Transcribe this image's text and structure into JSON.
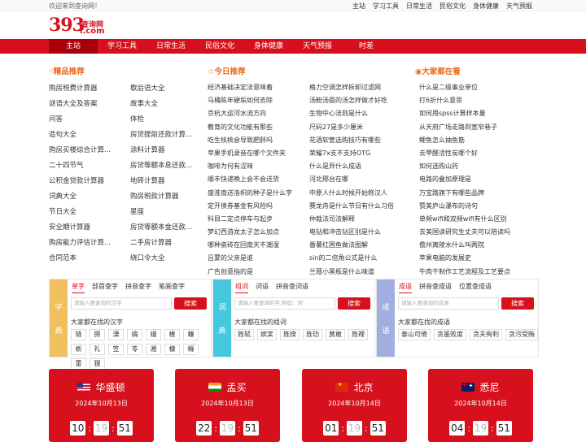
{
  "topbar": {
    "welcome": "欢迎来到查询网！",
    "links": [
      "主站",
      "学习工具",
      "日常生活",
      "民俗文化",
      "身体健康",
      "天气预报"
    ]
  },
  "logo": {
    "digits": "393",
    "cn": "查询网",
    "com": "r.com"
  },
  "nav": {
    "items": [
      "主站",
      "学习工具",
      "日常生活",
      "民俗文化",
      "身体健康",
      "天气预报",
      "时差"
    ]
  },
  "recommend": {
    "title": "精品推荐",
    "items": [
      "购房税费计算器",
      "歇后语大全",
      "谜语大全及答案",
      "故事大全",
      "问答",
      "体检",
      "造句大全",
      "房贷提前还款计算...",
      "购房买楼综合计算...",
      "涂料计算器",
      "二十四节气",
      "房贷等额本息还款...",
      "公积金贷款计算器",
      "地砖计算器",
      "词典大全",
      "购房税款计算器",
      "节日大全",
      "星座",
      "安全期计算器",
      "房贷等额本金还款...",
      "购房能力评估计算...",
      "二手房计算器",
      "合同范本",
      "绕口令大全"
    ]
  },
  "today": {
    "title": "今日推荐",
    "items": [
      "经济基础决定法意味着",
      "格力空调怎样拆卸过滤网",
      "马桶陈年硬垢如何去除",
      "汤粉汤面的汤怎样做才好吃",
      "京杭大运河水流方向",
      "生物中心法则是什么",
      "教育的文化功能有那些",
      "尺码27是多少厘米",
      "吃生核桃会导致肥胖吗",
      "花酒软管选购技巧有哪些",
      "苹果手机录音在哪个文件夹",
      "荣耀7x支不支持OTG",
      "咖啡为何有涩味",
      "什么是异什么成语",
      "顺丰快递晚上会不会送货",
      "河北邢台在哪",
      "盛淮南送洛枳的种子是什么字",
      "中原人什么时候开始称汉人",
      "定开债券基金有风险吗",
      "赛龙舟是什么节日有什么习俗",
      "科目二定点停车与起步",
      "仲裁法司法解释",
      "梦幻西游龙太子怎么加点",
      "电钻和冲击钻区别是什么",
      "哪种瓷砖在回南天不潮湿",
      "番薯红困鱼做法图解",
      "吕蒙的父亲是谁",
      "sin的二倍角公式是什么",
      "广告创意指的是",
      "兰蔻小黑瓶是什么味道"
    ]
  },
  "watching": {
    "title": "大家都在看",
    "items": [
      "什么是二级事业单位",
      "打6折什么意思",
      "如何用spss计算样本量",
      "从天府广场走路到宽窄巷子",
      "鲤鱼怎么抽鱼筋",
      "去甲醛活性炭哪个好",
      "如何选购山药",
      "电路的叠加原理是",
      "万宝路旗下有哪些品牌",
      "赞美庐山瀑布的诗句",
      "单频wifi和双频wifi有什么区别",
      "去美国读研究生丈夫可以陪读吗",
      "儋州离陵水什么叫两院",
      "苹果电脑的发展史",
      "牛肉干制作工艺流程及工艺要点"
    ]
  },
  "dicts": [
    {
      "side": [
        "字",
        "典"
      ],
      "color": "#f0c060",
      "tabs": [
        "单字",
        "部首查字",
        "拼音查字",
        "笔画查字"
      ],
      "placeholder": "请输入要查询的汉字",
      "button": "搜索",
      "hot_title": "大家都在找的汉字",
      "chips": [
        "链",
        "腭",
        "溧",
        "缟",
        "嫚",
        "楼",
        "蠊",
        "栃",
        "礼",
        "笠",
        "苓",
        "湘",
        "槺",
        "橼",
        "蕾",
        "狸"
      ]
    },
    {
      "side": [
        "词",
        "典"
      ],
      "color": "#45c7dd",
      "tabs": [
        "组词",
        "词语",
        "拼音查词语"
      ],
      "placeholder": "请输入要查询的字,例如：阿",
      "button": "搜索",
      "hot_title": "大家都在找的组词",
      "chips": [
        "旌轼",
        "嫔寀",
        "旌揆",
        "旌玏",
        "黄敢",
        "旌裡"
      ]
    },
    {
      "side": [
        "成",
        "语"
      ],
      "color": "#a3aee0",
      "tabs": [
        "成语",
        "拼音查成语",
        "位置查成语"
      ],
      "placeholder": "请输入要查询的成语",
      "button": "搜索",
      "hot_title": "大家都在找的成语",
      "chips": [
        "泰山可倚",
        "贪墨败度",
        "贪夫徇利",
        "贪污受贿"
      ]
    }
  ],
  "clocks": [
    {
      "city": "华盛顿",
      "date": "2024年10月13日",
      "h": "10",
      "m": "19",
      "s": "51",
      "flag": "us"
    },
    {
      "city": "孟买",
      "date": "2024年10月13日",
      "h": "22",
      "m": "19",
      "s": "51",
      "flag": "in"
    },
    {
      "city": "北京",
      "date": "2024年10月14日",
      "h": "01",
      "m": "19",
      "s": "51",
      "flag": "cn"
    },
    {
      "city": "悉尼",
      "date": "2024年10月14日",
      "h": "04",
      "m": "19",
      "s": "51",
      "flag": "au"
    }
  ]
}
